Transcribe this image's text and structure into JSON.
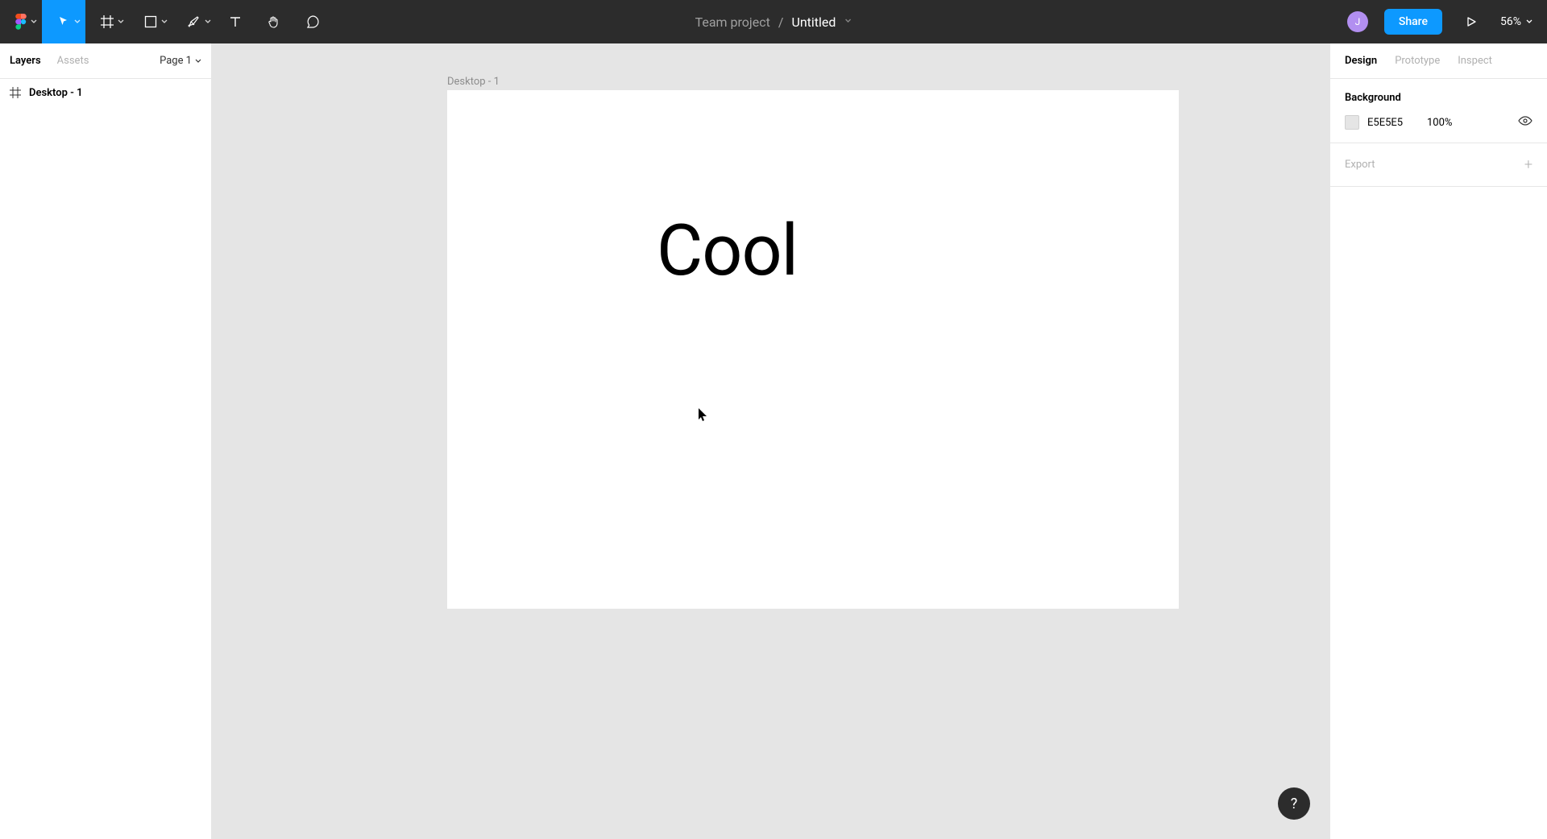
{
  "header": {
    "team_name": "Team project",
    "file_name": "Untitled",
    "avatar_initial": "J",
    "share_label": "Share",
    "zoom_label": "56%"
  },
  "left_panel": {
    "tabs": {
      "layers": "Layers",
      "assets": "Assets"
    },
    "page_label": "Page 1",
    "layers": [
      {
        "name": "Desktop - 1"
      }
    ]
  },
  "canvas": {
    "frame_label": "Desktop - 1",
    "text_content": "Cool"
  },
  "right_panel": {
    "tabs": {
      "design": "Design",
      "prototype": "Prototype",
      "inspect": "Inspect"
    },
    "background": {
      "title": "Background",
      "hex": "E5E5E5",
      "opacity": "100%"
    },
    "export_label": "Export"
  },
  "help_label": "?"
}
